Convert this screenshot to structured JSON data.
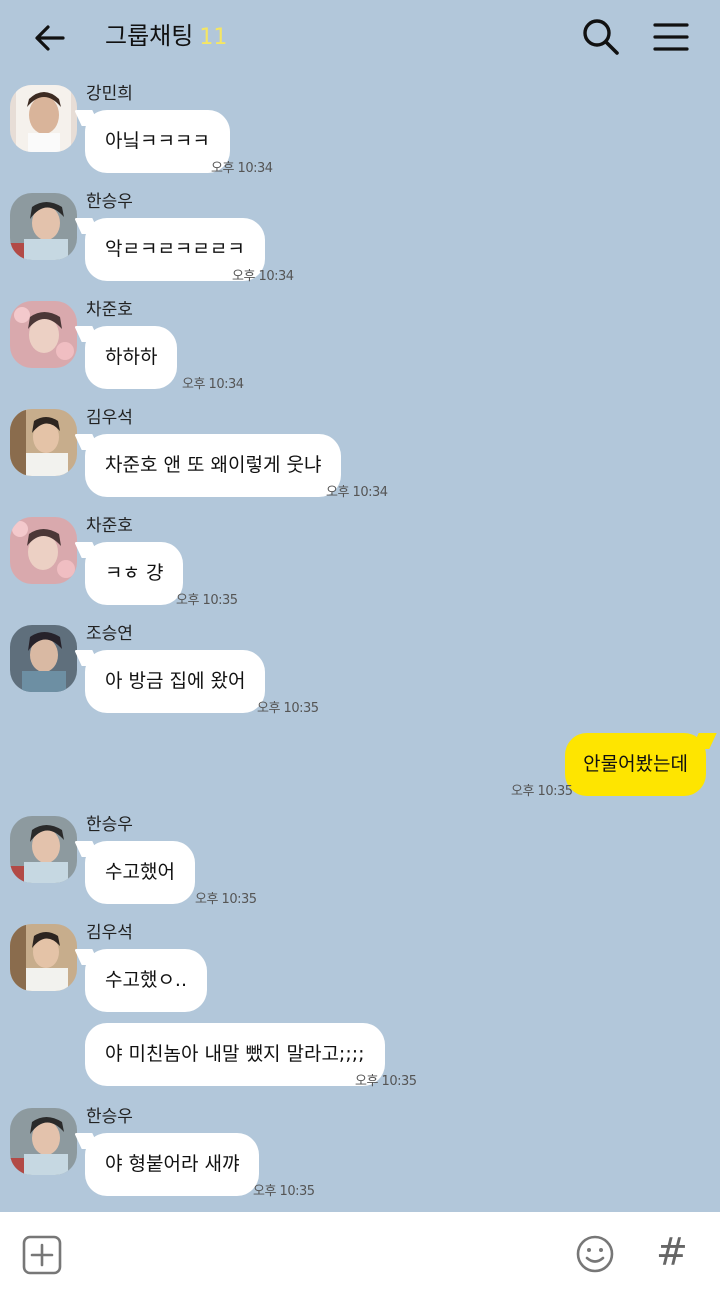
{
  "header": {
    "title": "그룹채팅",
    "member_count": "11"
  },
  "messages": [
    {
      "sender": "강민희",
      "text": "아닠ㅋㅋㅋㅋ",
      "time": "오후 10:34"
    },
    {
      "sender": "한승우",
      "text": "악ㄹㅋㄹㅋㄹㄹㅋ",
      "time": "오후 10:34"
    },
    {
      "sender": "차준호",
      "text": "하하하",
      "time": "오후 10:34"
    },
    {
      "sender": "김우석",
      "text": "차준호 앤 또 왜이렇게 웃냐",
      "time": "오후 10:34"
    },
    {
      "sender": "차준호",
      "text": "ㅋㅎ 걍",
      "time": "오후 10:35"
    },
    {
      "sender": "조승연",
      "text": "아 방금 집에 왔어",
      "time": "오후 10:35"
    },
    {
      "sender": "한승우",
      "text": "수고했어",
      "time": "오후 10:35"
    },
    {
      "sender": "김우석",
      "text": "수고했ㅇ..",
      "time": ""
    },
    {
      "sender": "",
      "text": "야 미친놈아 내말 뺐지 말라고;;;;",
      "time": "오후 10:35"
    },
    {
      "sender": "한승우",
      "text": "야 형붙어라 새꺄",
      "time": "오후 10:35"
    }
  ],
  "my_message": {
    "text": "안물어봤는데",
    "time": "오후 10:35"
  },
  "colors": {
    "background": "#b2c7da",
    "my_bubble": "#fee500",
    "other_bubble": "#ffffff",
    "member_count": "#f5e663"
  },
  "icons": {
    "back": "arrow-left-icon",
    "search": "search-icon",
    "menu": "hamburger-menu-icon",
    "attach": "plus-square-icon",
    "emoji": "smiley-icon",
    "hashtag": "hashtag-icon"
  },
  "bottom": {
    "hash": "#"
  }
}
